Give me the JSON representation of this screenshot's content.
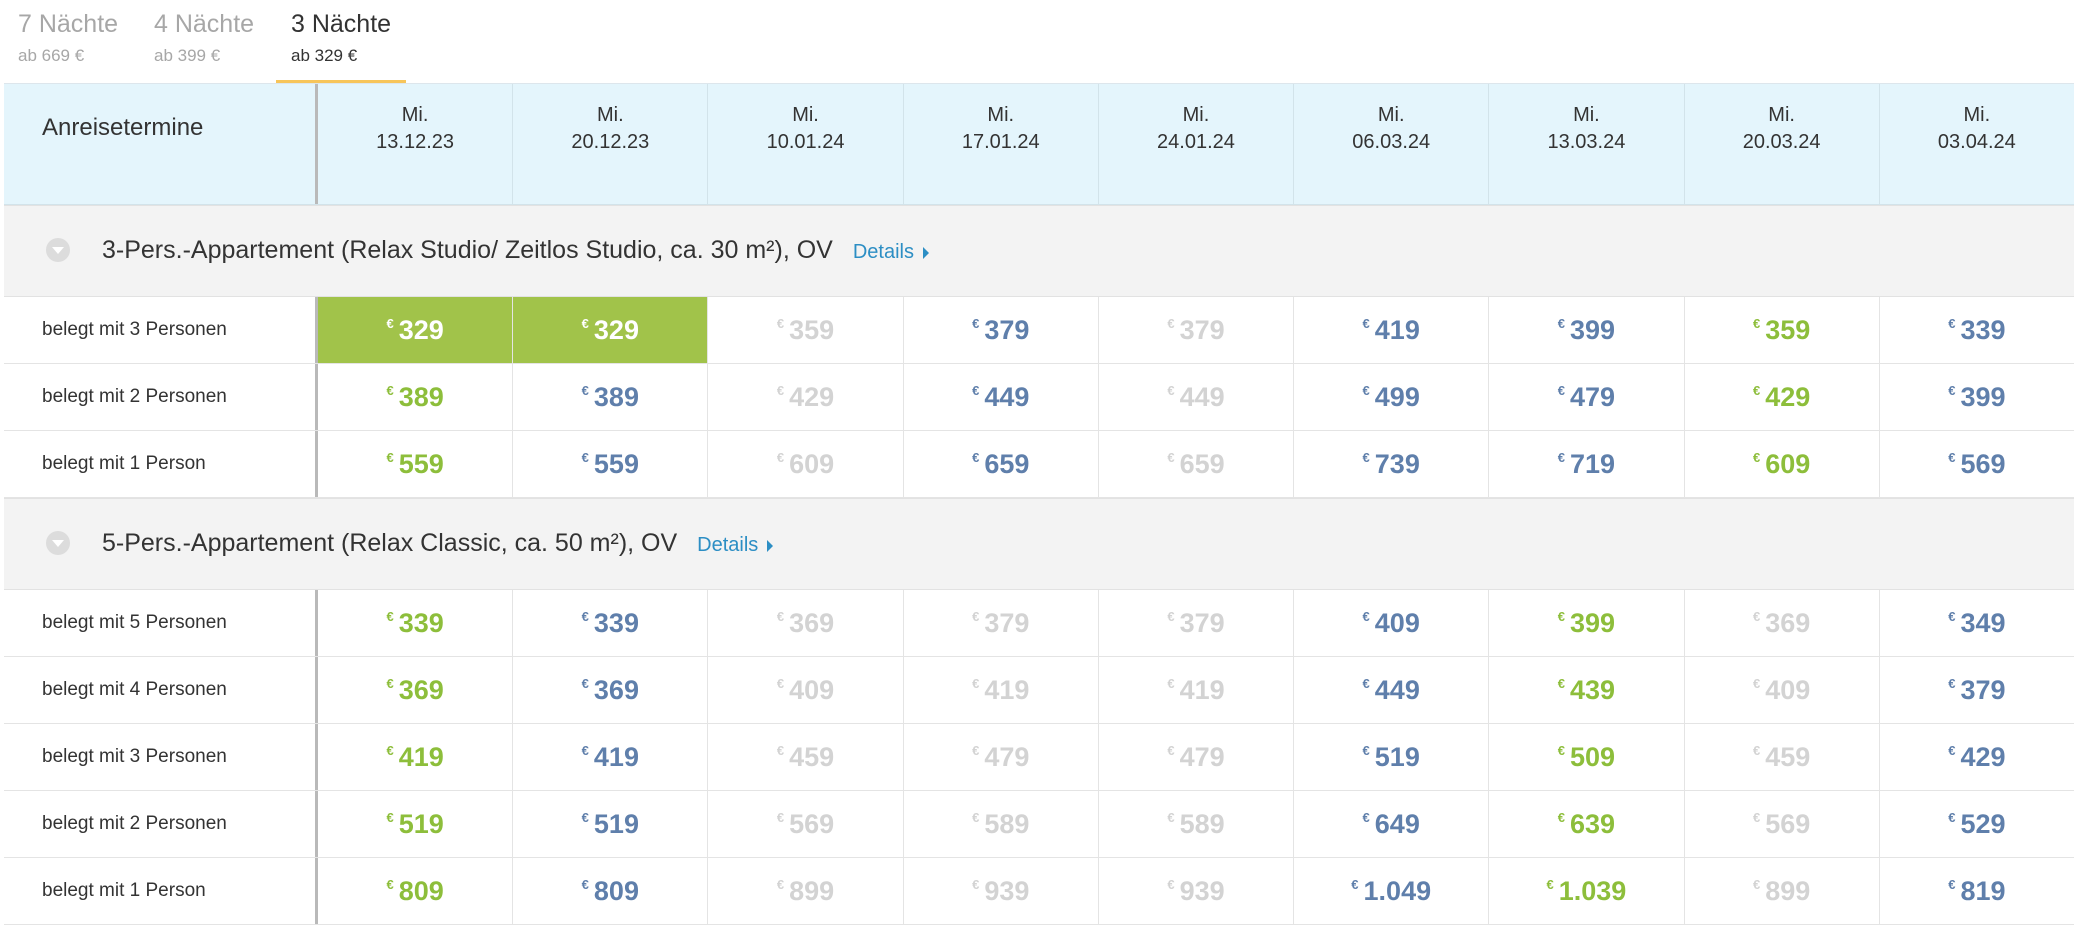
{
  "tabs": [
    {
      "label": "7 Nächte",
      "price": "ab 669 €",
      "active": false
    },
    {
      "label": "4 Nächte",
      "price": "ab 399 €",
      "active": false
    },
    {
      "label": "3 Nächte",
      "price": "ab 329 €",
      "active": true
    }
  ],
  "table": {
    "header_label": "Anreisetermine",
    "dates": [
      {
        "day": "Mi.",
        "date": "13.12.23"
      },
      {
        "day": "Mi.",
        "date": "20.12.23"
      },
      {
        "day": "Mi.",
        "date": "10.01.24"
      },
      {
        "day": "Mi.",
        "date": "17.01.24"
      },
      {
        "day": "Mi.",
        "date": "24.01.24"
      },
      {
        "day": "Mi.",
        "date": "06.03.24"
      },
      {
        "day": "Mi.",
        "date": "13.03.24"
      },
      {
        "day": "Mi.",
        "date": "20.03.24"
      },
      {
        "day": "Mi.",
        "date": "03.04.24"
      }
    ],
    "currency": "€",
    "details_label": "Details",
    "groups": [
      {
        "title": "3-Pers.-Appartement (Relax Studio/ Zeitlos Studio, ca. 30 m²), OV",
        "rows": [
          {
            "label": "belegt mit 3 Personen",
            "prices": [
              "329",
              "329",
              "359",
              "379",
              "379",
              "419",
              "399",
              "359",
              "339"
            ],
            "status": [
              "selected",
              "selected",
              "gray",
              "blue",
              "gray",
              "blue",
              "blue",
              "green",
              "blue"
            ]
          },
          {
            "label": "belegt mit 2 Personen",
            "prices": [
              "389",
              "389",
              "429",
              "449",
              "449",
              "499",
              "479",
              "429",
              "399"
            ],
            "status": [
              "green",
              "blue",
              "gray",
              "blue",
              "gray",
              "blue",
              "blue",
              "green",
              "blue"
            ]
          },
          {
            "label": "belegt mit 1 Person",
            "prices": [
              "559",
              "559",
              "609",
              "659",
              "659",
              "739",
              "719",
              "609",
              "569"
            ],
            "status": [
              "green",
              "blue",
              "gray",
              "blue",
              "gray",
              "blue",
              "blue",
              "green",
              "blue"
            ]
          }
        ]
      },
      {
        "title": "5-Pers.-Appartement (Relax Classic, ca. 50 m²), OV",
        "rows": [
          {
            "label": "belegt mit 5 Personen",
            "prices": [
              "339",
              "339",
              "369",
              "379",
              "379",
              "409",
              "399",
              "369",
              "349"
            ],
            "status": [
              "green",
              "blue",
              "gray",
              "gray",
              "gray",
              "blue",
              "green",
              "gray",
              "blue"
            ]
          },
          {
            "label": "belegt mit 4 Personen",
            "prices": [
              "369",
              "369",
              "409",
              "419",
              "419",
              "449",
              "439",
              "409",
              "379"
            ],
            "status": [
              "green",
              "blue",
              "gray",
              "gray",
              "gray",
              "blue",
              "green",
              "gray",
              "blue"
            ]
          },
          {
            "label": "belegt mit 3 Personen",
            "prices": [
              "419",
              "419",
              "459",
              "479",
              "479",
              "519",
              "509",
              "459",
              "429"
            ],
            "status": [
              "green",
              "blue",
              "gray",
              "gray",
              "gray",
              "blue",
              "green",
              "gray",
              "blue"
            ]
          },
          {
            "label": "belegt mit 2 Personen",
            "prices": [
              "519",
              "519",
              "569",
              "589",
              "589",
              "649",
              "639",
              "569",
              "529"
            ],
            "status": [
              "green",
              "blue",
              "gray",
              "gray",
              "gray",
              "blue",
              "green",
              "gray",
              "blue"
            ]
          },
          {
            "label": "belegt mit 1 Person",
            "prices": [
              "809",
              "809",
              "899",
              "939",
              "939",
              "1.049",
              "1.039",
              "899",
              "819"
            ],
            "status": [
              "green",
              "blue",
              "gray",
              "gray",
              "gray",
              "blue",
              "green",
              "gray",
              "blue"
            ]
          }
        ]
      }
    ]
  },
  "colors": {
    "green": "#8dbe3b",
    "blue": "#5f7fab",
    "gray": "#d3d3d3",
    "selected_bg": "#a1c34a",
    "header_bg": "#e4f5fc",
    "tab_underline": "#f7c55a",
    "link": "#2c8ec4"
  },
  "icons": {
    "group_toggle": "chevron-down-circle-icon",
    "details_caret": "caret-right-icon"
  }
}
